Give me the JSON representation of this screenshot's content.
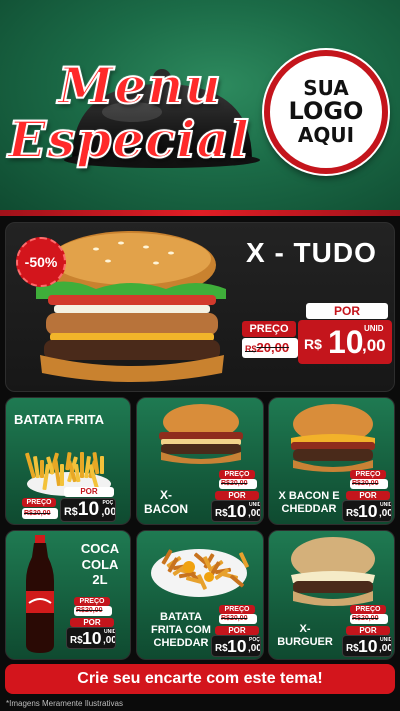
{
  "header": {
    "title_line1": "Menu",
    "title_line2": "Especial",
    "logo_line1": "SUA",
    "logo_line2": "LOGO",
    "logo_line3": "AQUI"
  },
  "hero": {
    "name": "X - TUDO",
    "discount": "-50%",
    "old_label": "PREÇO",
    "old_currency": "R$",
    "old_price": "20,00",
    "new_label": "POR",
    "unit": "UNID",
    "new_currency": "R$",
    "new_price_int": "10",
    "new_price_dec": ",00"
  },
  "items": [
    {
      "name": "BATATA FRITA",
      "old_label": "PREÇO",
      "old_price": "R$20,00",
      "new_label": "POR",
      "unit": "POÇ",
      "new_currency": "R$",
      "new_int": "10",
      "new_dec": ",00"
    },
    {
      "name": "X-\nBACON",
      "old_label": "PREÇO",
      "old_price": "R$20,00",
      "new_label": "POR",
      "unit": "UNID",
      "new_currency": "R$",
      "new_int": "10",
      "new_dec": ",00"
    },
    {
      "name": "X BACON E\nCHEDDAR",
      "old_label": "PREÇO",
      "old_price": "R$20,00",
      "new_label": "POR",
      "unit": "UNID",
      "new_currency": "R$",
      "new_int": "10",
      "new_dec": ",00"
    },
    {
      "name": "COCA\nCOLA\n2L",
      "old_label": "PREÇO",
      "old_price": "R$20,00",
      "new_label": "POR",
      "unit": "UNID",
      "new_currency": "R$",
      "new_int": "10",
      "new_dec": ",00"
    },
    {
      "name": "BATATA\nFRITA COM\nCHEDDAR",
      "old_label": "PREÇO",
      "old_price": "R$20,00",
      "new_label": "POR",
      "unit": "POÇ",
      "new_currency": "R$",
      "new_int": "10",
      "new_dec": ",00"
    },
    {
      "name": "X-\nBURGUER",
      "old_label": "PREÇO",
      "old_price": "R$20,00",
      "new_label": "POR",
      "unit": "UNID",
      "new_currency": "R$",
      "new_int": "10",
      "new_dec": ",00"
    }
  ],
  "footer": {
    "cta": "Crie seu encarte com este tema!",
    "note": "*Imagens Meramente Ilustrativas"
  },
  "colors": {
    "accent": "#c4151c",
    "green": "#1b6b47",
    "dark": "#171717"
  }
}
